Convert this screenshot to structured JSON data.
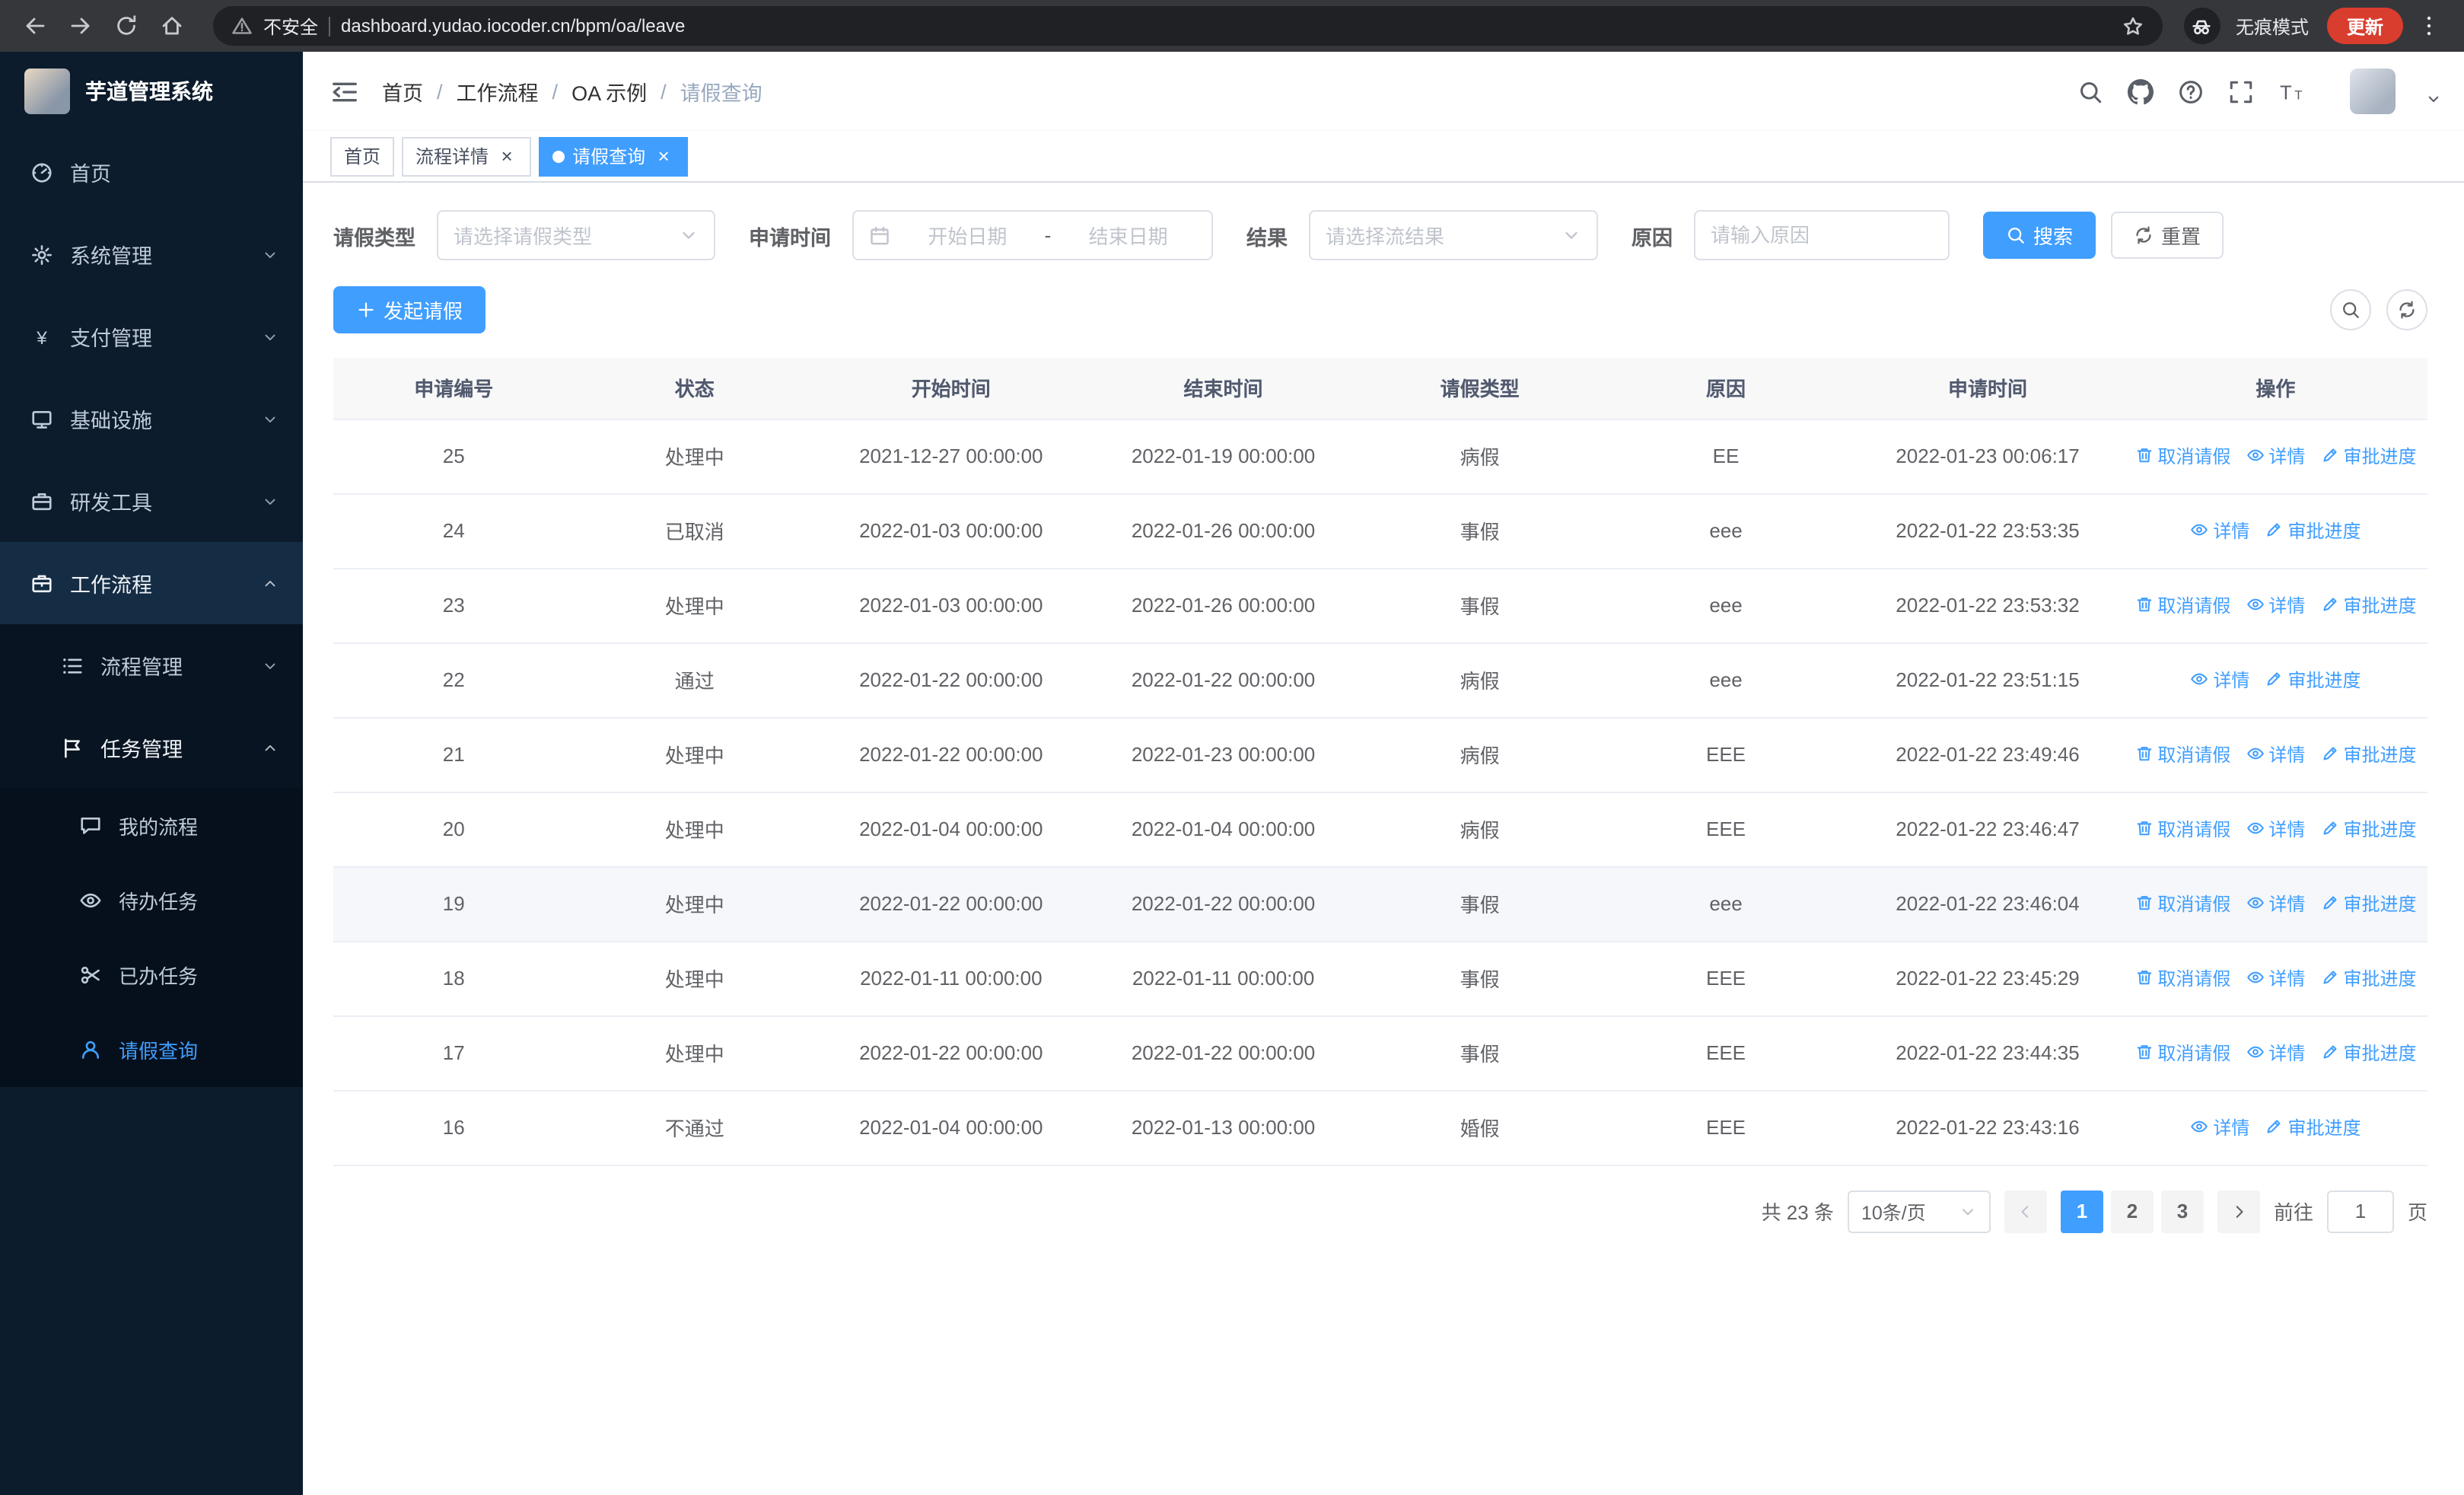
{
  "theme": {
    "primary": "#409eff",
    "chrome_bg": "#36373b",
    "address_bg": "#202124",
    "update_bg": "#d93d2e",
    "sidebar_bg": "#0c1c2c",
    "sidebar_sub_bg": "#081421",
    "sidebar_sub2_bg": "#06101c",
    "sidebar_open_bg": "#142c44"
  },
  "browser": {
    "security_label": "不安全",
    "url": "dashboard.yudao.iocoder.cn/bpm/oa/leave",
    "incognito_label": "无痕模式",
    "update_label": "更新"
  },
  "sidebar": {
    "app_title": "芋道管理系统",
    "items": [
      {
        "key": "home",
        "label": "首页",
        "icon": "dashboard-icon",
        "level": 1
      },
      {
        "key": "system-mgmt",
        "label": "系统管理",
        "icon": "gear-icon",
        "level": 1,
        "chevron": "down"
      },
      {
        "key": "payment-mgmt",
        "label": "支付管理",
        "icon": "yen-icon",
        "level": 1,
        "chevron": "down"
      },
      {
        "key": "infrastructure",
        "label": "基础设施",
        "icon": "infra-icon",
        "level": 1,
        "chevron": "down"
      },
      {
        "key": "dev-tools",
        "label": "研发工具",
        "icon": "tools-icon",
        "level": 1,
        "chevron": "down"
      },
      {
        "key": "workflow",
        "label": "工作流程",
        "icon": "workflow-icon",
        "level": 1,
        "chevron": "up",
        "open": true
      },
      {
        "key": "process-mgmt",
        "label": "流程管理",
        "icon": "list-icon",
        "level": 2,
        "chevron": "down"
      },
      {
        "key": "task-mgmt",
        "label": "任务管理",
        "icon": "task-icon",
        "level": 2,
        "chevron": "up",
        "open": true
      },
      {
        "key": "my-process",
        "label": "我的流程",
        "icon": "chat-icon",
        "level": 3
      },
      {
        "key": "todo-tasks",
        "label": "待办任务",
        "icon": "eye-icon",
        "level": 3
      },
      {
        "key": "done-tasks",
        "label": "已办任务",
        "icon": "scissors-icon",
        "level": 3
      },
      {
        "key": "leave-query",
        "label": "请假查询",
        "icon": "user-icon",
        "level": 3,
        "active": true
      }
    ]
  },
  "navbar": {
    "breadcrumb": [
      "首页",
      "工作流程",
      "OA 示例",
      "请假查询"
    ],
    "tools": [
      "search-icon",
      "github-icon",
      "question-icon",
      "fullscreen-icon",
      "font-size-icon"
    ]
  },
  "tabs": [
    {
      "key": "home",
      "label": "首页",
      "closable": false,
      "active": false
    },
    {
      "key": "process-detail",
      "label": "流程详情",
      "closable": true,
      "active": false
    },
    {
      "key": "leave-query",
      "label": "请假查询",
      "closable": true,
      "active": true
    }
  ],
  "filters": {
    "leave_type_label": "请假类型",
    "leave_type_placeholder": "请选择请假类型",
    "apply_time_label": "申请时间",
    "start_date_placeholder": "开始日期",
    "range_separator": "-",
    "end_date_placeholder": "结束日期",
    "result_label": "结果",
    "result_placeholder": "请选择流结果",
    "reason_label": "原因",
    "reason_placeholder": "请输入原因",
    "search_label": "搜索",
    "reset_label": "重置"
  },
  "toolbar": {
    "create_label": "发起请假"
  },
  "table": {
    "columns": [
      "申请编号",
      "状态",
      "开始时间",
      "结束时间",
      "请假类型",
      "原因",
      "申请时间",
      "操作"
    ],
    "action_defs": {
      "cancel": {
        "label": "取消请假",
        "icon": "delete-icon"
      },
      "detail": {
        "label": "详情",
        "icon": "eye-icon"
      },
      "progress": {
        "label": "审批进度",
        "icon": "edit-icon"
      }
    },
    "highlighted_row": "19",
    "rows": [
      {
        "id": "25",
        "status": "处理中",
        "start_time": "2021-12-27 00:00:00",
        "end_time": "2022-01-19 00:00:00",
        "leave_type": "病假",
        "reason": "EE",
        "apply_time": "2022-01-23 00:06:17",
        "actions": [
          "cancel",
          "detail",
          "progress"
        ]
      },
      {
        "id": "24",
        "status": "已取消",
        "start_time": "2022-01-03 00:00:00",
        "end_time": "2022-01-26 00:00:00",
        "leave_type": "事假",
        "reason": "eee",
        "apply_time": "2022-01-22 23:53:35",
        "actions": [
          "detail",
          "progress"
        ]
      },
      {
        "id": "23",
        "status": "处理中",
        "start_time": "2022-01-03 00:00:00",
        "end_time": "2022-01-26 00:00:00",
        "leave_type": "事假",
        "reason": "eee",
        "apply_time": "2022-01-22 23:53:32",
        "actions": [
          "cancel",
          "detail",
          "progress"
        ]
      },
      {
        "id": "22",
        "status": "通过",
        "start_time": "2022-01-22 00:00:00",
        "end_time": "2022-01-22 00:00:00",
        "leave_type": "病假",
        "reason": "eee",
        "apply_time": "2022-01-22 23:51:15",
        "actions": [
          "detail",
          "progress"
        ]
      },
      {
        "id": "21",
        "status": "处理中",
        "start_time": "2022-01-22 00:00:00",
        "end_time": "2022-01-23 00:00:00",
        "leave_type": "病假",
        "reason": "EEE",
        "apply_time": "2022-01-22 23:49:46",
        "actions": [
          "cancel",
          "detail",
          "progress"
        ]
      },
      {
        "id": "20",
        "status": "处理中",
        "start_time": "2022-01-04 00:00:00",
        "end_time": "2022-01-04 00:00:00",
        "leave_type": "病假",
        "reason": "EEE",
        "apply_time": "2022-01-22 23:46:47",
        "actions": [
          "cancel",
          "detail",
          "progress"
        ]
      },
      {
        "id": "19",
        "status": "处理中",
        "start_time": "2022-01-22 00:00:00",
        "end_time": "2022-01-22 00:00:00",
        "leave_type": "事假",
        "reason": "eee",
        "apply_time": "2022-01-22 23:46:04",
        "actions": [
          "cancel",
          "detail",
          "progress"
        ]
      },
      {
        "id": "18",
        "status": "处理中",
        "start_time": "2022-01-11 00:00:00",
        "end_time": "2022-01-11 00:00:00",
        "leave_type": "事假",
        "reason": "EEE",
        "apply_time": "2022-01-22 23:45:29",
        "actions": [
          "cancel",
          "detail",
          "progress"
        ]
      },
      {
        "id": "17",
        "status": "处理中",
        "start_time": "2022-01-22 00:00:00",
        "end_time": "2022-01-22 00:00:00",
        "leave_type": "事假",
        "reason": "EEE",
        "apply_time": "2022-01-22 23:44:35",
        "actions": [
          "cancel",
          "detail",
          "progress"
        ]
      },
      {
        "id": "16",
        "status": "不通过",
        "start_time": "2022-01-04 00:00:00",
        "end_time": "2022-01-13 00:00:00",
        "leave_type": "婚假",
        "reason": "EEE",
        "apply_time": "2022-01-22 23:43:16",
        "actions": [
          "detail",
          "progress"
        ]
      }
    ]
  },
  "pagination": {
    "total_text": "共 23 条",
    "page_size_label": "10条/页",
    "pages": [
      "1",
      "2",
      "3"
    ],
    "active_page": "1",
    "goto_label": "前往",
    "goto_value": "1",
    "page_unit": "页"
  }
}
